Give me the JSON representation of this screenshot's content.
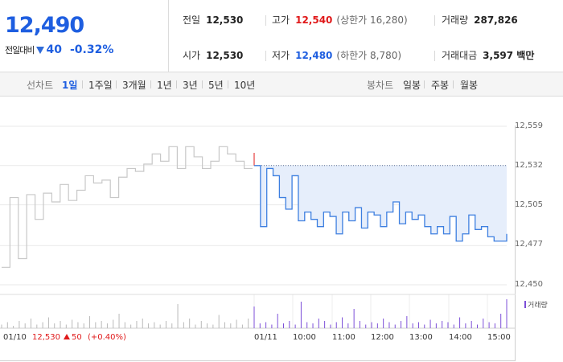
{
  "quote": {
    "price": "12,490",
    "change_label": "전일대비",
    "change_value": "40",
    "change_rate": "-0.32%"
  },
  "stats": {
    "prev_close_label": "전일",
    "prev_close": "12,530",
    "high_label": "고가",
    "high": "12,540",
    "upper_limit": "(상한가 16,280)",
    "volume_label": "거래량",
    "volume": "287,826",
    "open_label": "시가",
    "open": "12,530",
    "low_label": "저가",
    "low": "12,480",
    "lower_limit": "(하한가 8,780)",
    "amount_label": "거래대금",
    "amount": "3,597 백만"
  },
  "tabs": {
    "line_label": "선차트",
    "line_periods": [
      "1일",
      "1주일",
      "3개월",
      "1년",
      "3년",
      "5년",
      "10년"
    ],
    "active_period": "1일",
    "candle_label": "봉차트",
    "candle_periods": [
      "일봉",
      "주봉",
      "월봉"
    ]
  },
  "colors": {
    "accent_blue": "#1e5ee0",
    "up_red": "#e0191a",
    "prev_day_line": "#c8c8c8",
    "today_line": "#3d7fe0",
    "today_fill": "#e6eefb",
    "volume_bar": "#7c4fd8"
  },
  "chart_data": {
    "type": "line",
    "y_ticks": [
      "12,559",
      "12,532",
      "12,505",
      "12,477",
      "12,450"
    ],
    "ylim": [
      12450,
      12559
    ],
    "x_ticks": [
      "01/11",
      "10:00",
      "11:00",
      "12:00",
      "13:00",
      "14:00",
      "15:00"
    ],
    "reference_price": 12532,
    "prev_day": {
      "label": "01/10",
      "close": "12,530",
      "change": "50",
      "change_rate": "(+0.40%)",
      "values": [
        12462,
        12510,
        12468,
        12512,
        12495,
        12513,
        12507,
        12519,
        12508,
        12515,
        12525,
        12520,
        12522,
        12510,
        12524,
        12530,
        12528,
        12533,
        12540,
        12535,
        12545,
        12530,
        12545,
        12538,
        12530,
        12535,
        12545,
        12540,
        12535,
        12530,
        12530
      ]
    },
    "today": {
      "label": "01/11",
      "values": [
        12532,
        12490,
        12530,
        12525,
        12510,
        12502,
        12525,
        12494,
        12500,
        12495,
        12490,
        12500,
        12497,
        12485,
        12500,
        12494,
        12503,
        12489,
        12500,
        12498,
        12490,
        12500,
        12507,
        12492,
        12500,
        12495,
        12498,
        12490,
        12485,
        12490,
        12485,
        12497,
        12480,
        12485,
        12498,
        12488,
        12490,
        12483,
        12480,
        12480,
        12485
      ]
    },
    "volume_label": "거래량",
    "volume": [
      3,
      5,
      2,
      6,
      4,
      8,
      3,
      5,
      9,
      4,
      6,
      3,
      7,
      5,
      4,
      10,
      5,
      6,
      4,
      7,
      12,
      5,
      3,
      6,
      8,
      4,
      5,
      3,
      6,
      4,
      20,
      5,
      8,
      3,
      6,
      4,
      3,
      11,
      5,
      4,
      7,
      3,
      8,
      18,
      4,
      5,
      3,
      12,
      4,
      6,
      3,
      22,
      5,
      4,
      8,
      6,
      3,
      5,
      9,
      4,
      16,
      6,
      3,
      5,
      4,
      8,
      5,
      3,
      6,
      10,
      4,
      5,
      3,
      7,
      4,
      6,
      5,
      3,
      9,
      4,
      6,
      3,
      8,
      5,
      4,
      12,
      24
    ]
  }
}
